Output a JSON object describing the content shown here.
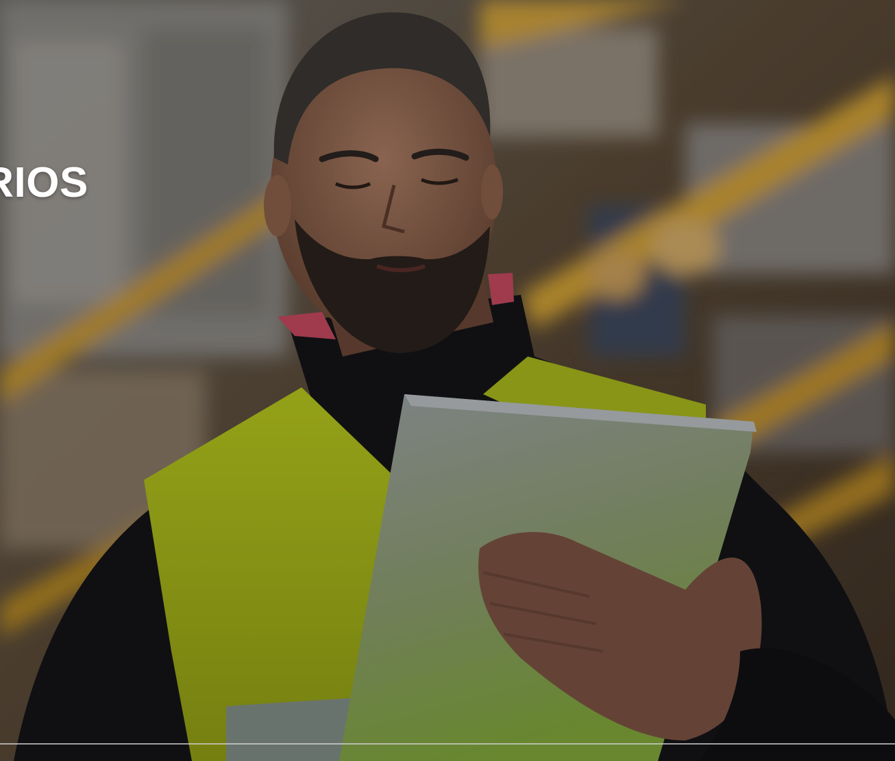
{
  "hero": {
    "title": "ARIOS",
    "image_subject": "warehouse-worker-with-tablet",
    "accent_color": "#c9d62a"
  }
}
